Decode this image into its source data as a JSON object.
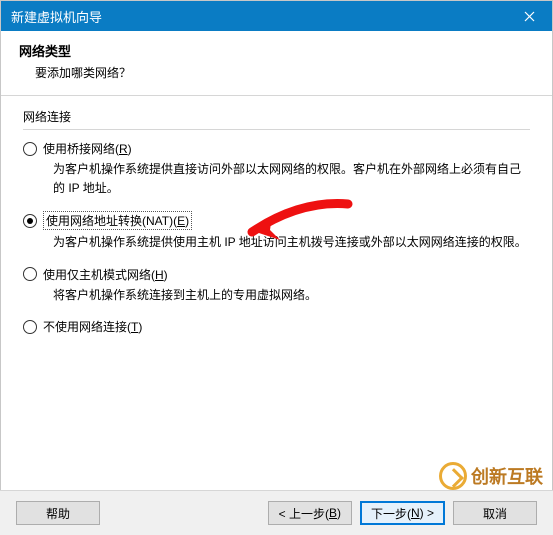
{
  "window": {
    "title": "新建虚拟机向导"
  },
  "header": {
    "title": "网络类型",
    "subtitle": "要添加哪类网络？"
  },
  "group": {
    "label": "网络连接"
  },
  "options": {
    "bridge": {
      "label_pre": "使用桥接网络(",
      "mn": "R",
      "label_post": ")",
      "desc": "为客户机操作系统提供直接访问外部以太网网络的权限。客户机在外部网络上必须有自己的 IP 地址。"
    },
    "nat": {
      "label_pre": "使用网络地址转换(NAT)(",
      "mn": "E",
      "label_post": ")",
      "desc": "为客户机操作系统提供使用主机 IP 地址访问主机拨号连接或外部以太网网络连接的权限。"
    },
    "hostonly": {
      "label_pre": "使用仅主机模式网络(",
      "mn": "H",
      "label_post": ")",
      "desc": "将客户机操作系统连接到主机上的专用虚拟网络。"
    },
    "none": {
      "label_pre": "不使用网络连接(",
      "mn": "T",
      "label_post": ")"
    }
  },
  "buttons": {
    "help": "帮助",
    "back_pre": "< 上一步(",
    "back_mn": "B",
    "back_post": ")",
    "next_pre": "下一步(",
    "next_mn": "N",
    "next_post": ") >",
    "cancel": "取消"
  },
  "watermark": {
    "text": "创新互联"
  }
}
